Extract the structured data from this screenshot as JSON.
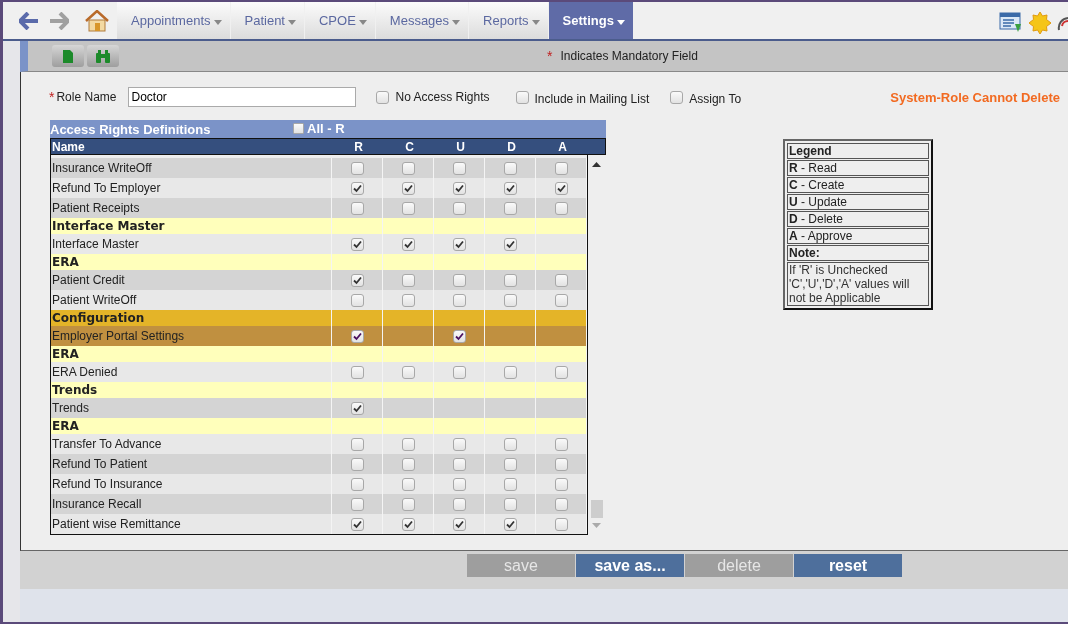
{
  "nav": {
    "tabs": [
      {
        "label": "Appointments",
        "selected": false
      },
      {
        "label": "Patient",
        "selected": false
      },
      {
        "label": "CPOE",
        "selected": false
      },
      {
        "label": "Messages",
        "selected": false
      },
      {
        "label": "Reports",
        "selected": false
      },
      {
        "label": "Settings",
        "selected": true
      }
    ]
  },
  "toolbar": {
    "required_mark": "*",
    "mandatory_note": "Indicates Mandatory Field"
  },
  "form": {
    "role_name": {
      "label": "Role Name",
      "value": "Doctor",
      "required": true
    },
    "options": [
      {
        "label": "No Access Rights",
        "checked": false
      },
      {
        "label": "Include in Mailing List",
        "checked": false
      },
      {
        "label": "Assign To",
        "checked": false
      }
    ],
    "notice": "System-Role Cannot Delete"
  },
  "table": {
    "title": "Access Rights Definitions",
    "all_toggle": {
      "label": "All - R",
      "checked": false
    },
    "columns": [
      "Name",
      "R",
      "C",
      "U",
      "D",
      "A"
    ],
    "rows": [
      {
        "kind": "item",
        "name": "Insurance WriteOff",
        "highlighted": false,
        "cells": [
          {
            "kind": "checkbox",
            "checked": false
          },
          {
            "kind": "checkbox",
            "checked": false
          },
          {
            "kind": "checkbox",
            "checked": false
          },
          {
            "kind": "checkbox",
            "checked": false
          },
          {
            "kind": "checkbox",
            "checked": false
          }
        ]
      },
      {
        "kind": "item",
        "name": "Refund To Employer",
        "highlighted": false,
        "cells": [
          {
            "kind": "checkbox",
            "checked": true
          },
          {
            "kind": "checkbox",
            "checked": true
          },
          {
            "kind": "checkbox",
            "checked": true
          },
          {
            "kind": "checkbox",
            "checked": true
          },
          {
            "kind": "checkbox",
            "checked": true
          }
        ]
      },
      {
        "kind": "item",
        "name": "Patient Receipts",
        "highlighted": false,
        "cells": [
          {
            "kind": "checkbox",
            "checked": false
          },
          {
            "kind": "checkbox",
            "checked": false
          },
          {
            "kind": "checkbox",
            "checked": false
          },
          {
            "kind": "checkbox",
            "checked": false
          },
          {
            "kind": "checkbox",
            "checked": false
          }
        ]
      },
      {
        "kind": "group",
        "name": "Interface Master",
        "highlighted": false
      },
      {
        "kind": "item",
        "name": "Interface Master",
        "highlighted": false,
        "cells": [
          {
            "kind": "checkbox",
            "checked": true
          },
          {
            "kind": "checkbox",
            "checked": true
          },
          {
            "kind": "checkbox",
            "checked": true
          },
          {
            "kind": "checkbox",
            "checked": true
          },
          {
            "kind": "empty"
          }
        ]
      },
      {
        "kind": "group",
        "name": "ERA",
        "highlighted": false
      },
      {
        "kind": "item",
        "name": "Patient Credit",
        "highlighted": false,
        "cells": [
          {
            "kind": "checkbox",
            "checked": true
          },
          {
            "kind": "checkbox",
            "checked": false
          },
          {
            "kind": "checkbox",
            "checked": false
          },
          {
            "kind": "checkbox",
            "checked": false
          },
          {
            "kind": "checkbox",
            "checked": false
          }
        ]
      },
      {
        "kind": "item",
        "name": "Patient WriteOff",
        "highlighted": false,
        "cells": [
          {
            "kind": "checkbox",
            "checked": false
          },
          {
            "kind": "checkbox",
            "checked": false
          },
          {
            "kind": "checkbox",
            "checked": false
          },
          {
            "kind": "checkbox",
            "checked": false
          },
          {
            "kind": "checkbox",
            "checked": false
          }
        ]
      },
      {
        "kind": "group",
        "name": "Configuration",
        "highlighted": true
      },
      {
        "kind": "item",
        "name": "Employer Portal Settings",
        "highlighted": true,
        "cells": [
          {
            "kind": "checkbox",
            "checked": true
          },
          {
            "kind": "empty"
          },
          {
            "kind": "checkbox",
            "checked": true
          },
          {
            "kind": "empty"
          },
          {
            "kind": "empty"
          }
        ]
      },
      {
        "kind": "group",
        "name": "ERA",
        "highlighted": false
      },
      {
        "kind": "item",
        "name": "ERA Denied",
        "highlighted": false,
        "cells": [
          {
            "kind": "checkbox",
            "checked": false
          },
          {
            "kind": "checkbox",
            "checked": false
          },
          {
            "kind": "checkbox",
            "checked": false
          },
          {
            "kind": "checkbox",
            "checked": false
          },
          {
            "kind": "checkbox",
            "checked": false
          }
        ]
      },
      {
        "kind": "group",
        "name": "Trends",
        "highlighted": false
      },
      {
        "kind": "item",
        "name": "Trends",
        "highlighted": false,
        "cells": [
          {
            "kind": "checkbox",
            "checked": true
          },
          {
            "kind": "empty"
          },
          {
            "kind": "empty"
          },
          {
            "kind": "empty"
          },
          {
            "kind": "empty"
          }
        ]
      },
      {
        "kind": "group",
        "name": "ERA",
        "highlighted": false
      },
      {
        "kind": "item",
        "name": "Transfer To Advance",
        "highlighted": false,
        "cells": [
          {
            "kind": "checkbox",
            "checked": false
          },
          {
            "kind": "checkbox",
            "checked": false
          },
          {
            "kind": "checkbox",
            "checked": false
          },
          {
            "kind": "checkbox",
            "checked": false
          },
          {
            "kind": "checkbox",
            "checked": false
          }
        ]
      },
      {
        "kind": "item",
        "name": "Refund To Patient",
        "highlighted": false,
        "cells": [
          {
            "kind": "checkbox",
            "checked": false
          },
          {
            "kind": "checkbox",
            "checked": false
          },
          {
            "kind": "checkbox",
            "checked": false
          },
          {
            "kind": "checkbox",
            "checked": false
          },
          {
            "kind": "checkbox",
            "checked": false
          }
        ]
      },
      {
        "kind": "item",
        "name": "Refund To Insurance",
        "highlighted": false,
        "cells": [
          {
            "kind": "checkbox",
            "checked": false
          },
          {
            "kind": "checkbox",
            "checked": false
          },
          {
            "kind": "checkbox",
            "checked": false
          },
          {
            "kind": "checkbox",
            "checked": false
          },
          {
            "kind": "checkbox",
            "checked": false
          }
        ]
      },
      {
        "kind": "item",
        "name": "Insurance Recall",
        "highlighted": false,
        "cells": [
          {
            "kind": "checkbox",
            "checked": false
          },
          {
            "kind": "checkbox",
            "checked": false
          },
          {
            "kind": "checkbox",
            "checked": false
          },
          {
            "kind": "checkbox",
            "checked": false
          },
          {
            "kind": "checkbox",
            "checked": false
          }
        ]
      },
      {
        "kind": "item",
        "name": "Patient wise Remittance",
        "highlighted": false,
        "cells": [
          {
            "kind": "checkbox",
            "checked": true
          },
          {
            "kind": "checkbox",
            "checked": true
          },
          {
            "kind": "checkbox",
            "checked": true
          },
          {
            "kind": "checkbox",
            "checked": true
          },
          {
            "kind": "checkbox",
            "checked": false
          }
        ]
      }
    ]
  },
  "legend": {
    "title": "Legend",
    "items": [
      "**R** - Read",
      "**C** - Create",
      "**U** - Update",
      "**D** - Delete",
      "**A** - Approve"
    ],
    "note_title": "Note:",
    "note": "If 'R' is Unchecked 'C','U','D','A' values will not be Applicable"
  },
  "buttons": [
    {
      "label": "save",
      "disabled": true
    },
    {
      "label": "save as...",
      "disabled": false
    },
    {
      "label": "delete",
      "disabled": true
    },
    {
      "label": "reset",
      "disabled": false
    }
  ]
}
